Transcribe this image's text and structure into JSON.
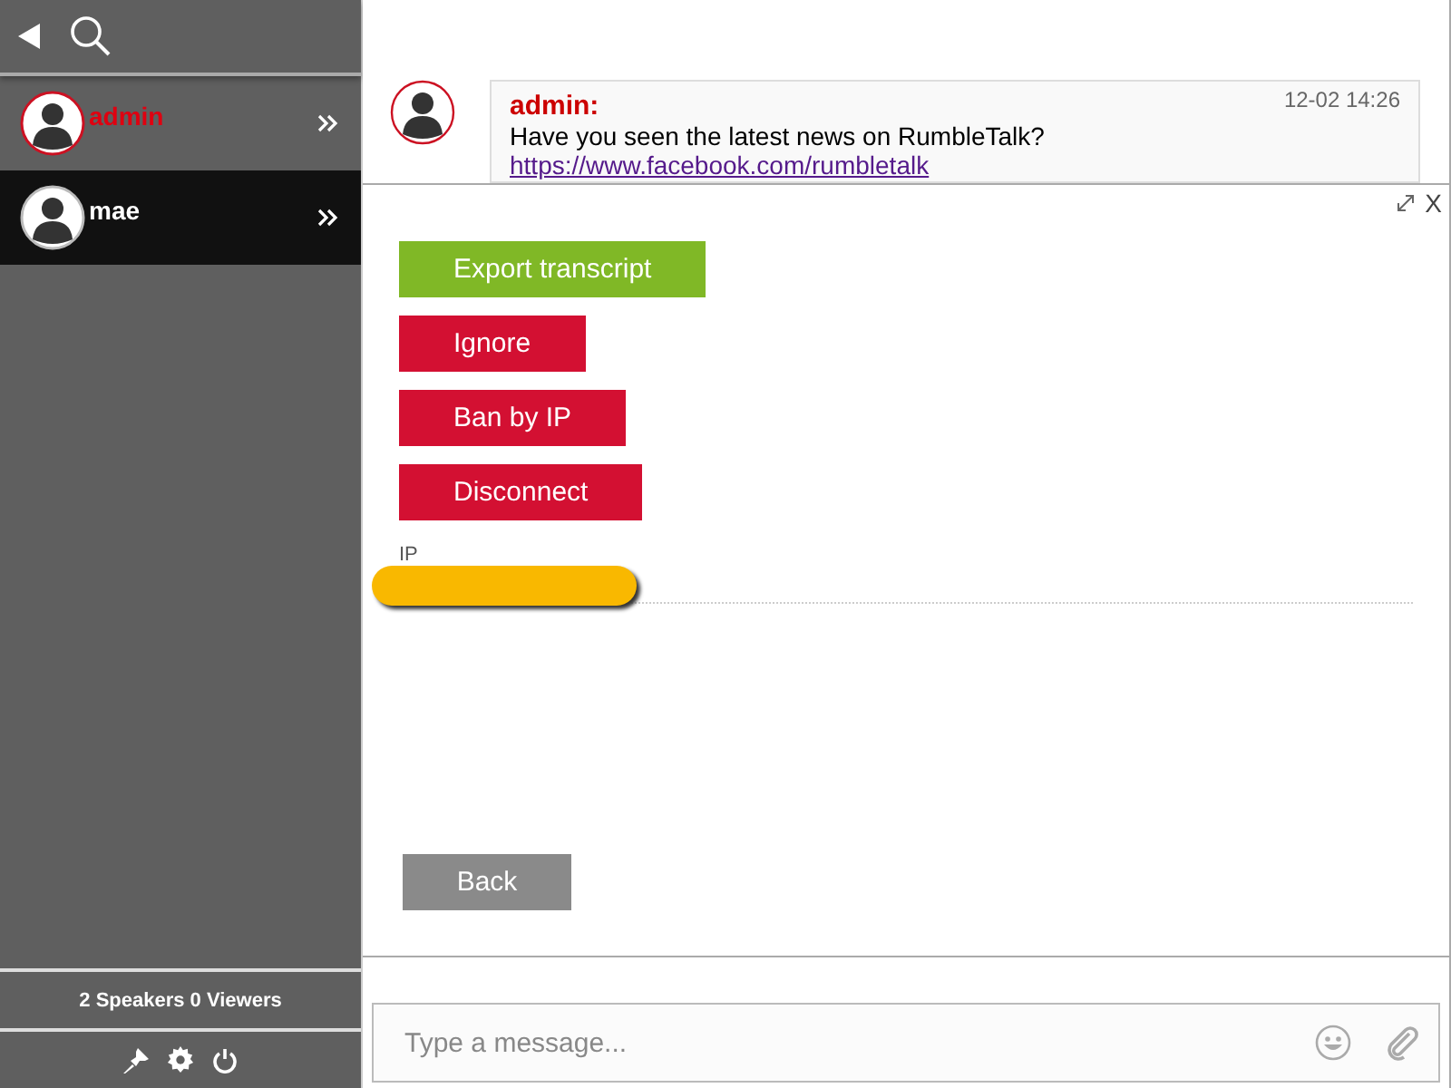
{
  "sidebar": {
    "users": [
      {
        "name": "admin",
        "kind": "admin",
        "selected": false
      },
      {
        "name": "mae",
        "kind": "user",
        "selected": true
      }
    ],
    "stats": {
      "speakers": "2",
      "speakers_label": "Speakers",
      "viewers": "0",
      "viewers_label": "Viewers"
    }
  },
  "message": {
    "author": "admin:",
    "time": "12-02 14:26",
    "text": "Have you seen the latest news on RumbleTalk?",
    "link": "https://www.facebook.com/rumbletalk"
  },
  "panel": {
    "close": "X",
    "actions": [
      {
        "label": "Export transcript",
        "kind": "export"
      },
      {
        "label": "Ignore",
        "kind": "danger"
      },
      {
        "label": "Ban by IP",
        "kind": "danger"
      },
      {
        "label": "Disconnect",
        "kind": "danger"
      }
    ],
    "ip_label": "IP",
    "back": "Back"
  },
  "composer": {
    "placeholder": "Type a message..."
  }
}
